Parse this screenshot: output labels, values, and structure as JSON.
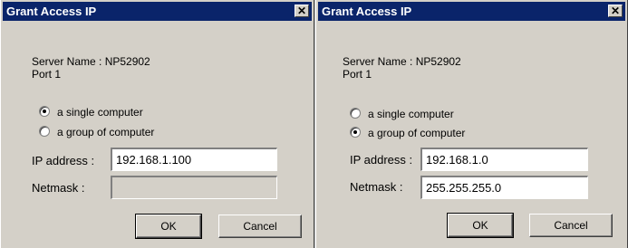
{
  "dialogs": [
    {
      "title": "Grant Access IP",
      "close_glyph": "✕",
      "server_name": "Server Name : NP52902",
      "port": "Port 1",
      "radio_single": "a single computer",
      "radio_group": "a group of computer",
      "selected": "single",
      "ip_label": "IP address :",
      "ip_value": "192.168.1.100",
      "netmask_label": "Netmask :",
      "netmask_value": "",
      "netmask_enabled": false,
      "ok_label": "OK",
      "cancel_label": "Cancel"
    },
    {
      "title": "Grant Access IP",
      "close_glyph": "✕",
      "server_name": "Server Name : NP52902",
      "port": "Port 1",
      "radio_single": "a single computer",
      "radio_group": "a group of computer",
      "selected": "group",
      "ip_label": "IP address :",
      "ip_value": "192.168.1.0",
      "netmask_label": "Netmask :",
      "netmask_value": "255.255.255.0",
      "netmask_enabled": true,
      "ok_label": "OK",
      "cancel_label": "Cancel"
    }
  ],
  "colors": {
    "titlebar": "#0a246a",
    "dialog_bg": "#d4d0c8"
  }
}
